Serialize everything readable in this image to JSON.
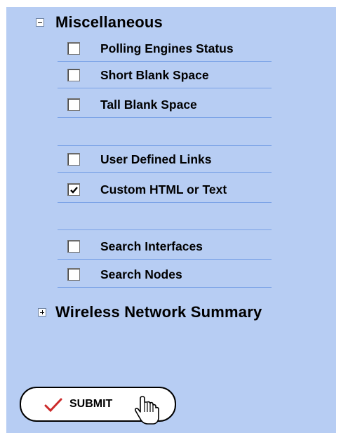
{
  "groups": [
    {
      "title": "Miscellaneous",
      "state": "expanded"
    },
    {
      "title": "Wireless Network Summary",
      "state": "collapsed"
    }
  ],
  "items": [
    {
      "label": "Polling Engines Status",
      "checked": false
    },
    {
      "label": "Short Blank Space",
      "checked": false
    },
    {
      "label": "Tall Blank Space",
      "checked": false
    },
    {
      "label": "",
      "checked": null
    },
    {
      "label": "User Defined Links",
      "checked": false
    },
    {
      "label": "Custom HTML or Text",
      "checked": true
    },
    {
      "label": "",
      "checked": null
    },
    {
      "label": "Search Interfaces",
      "checked": false
    },
    {
      "label": "Search Nodes",
      "checked": false
    }
  ],
  "submit": {
    "label": "SUBMIT",
    "icon": "check-icon",
    "accent": "#cc2a2a"
  },
  "colors": {
    "panel": "#b7cdf3",
    "divider": "#7aa2e6"
  }
}
